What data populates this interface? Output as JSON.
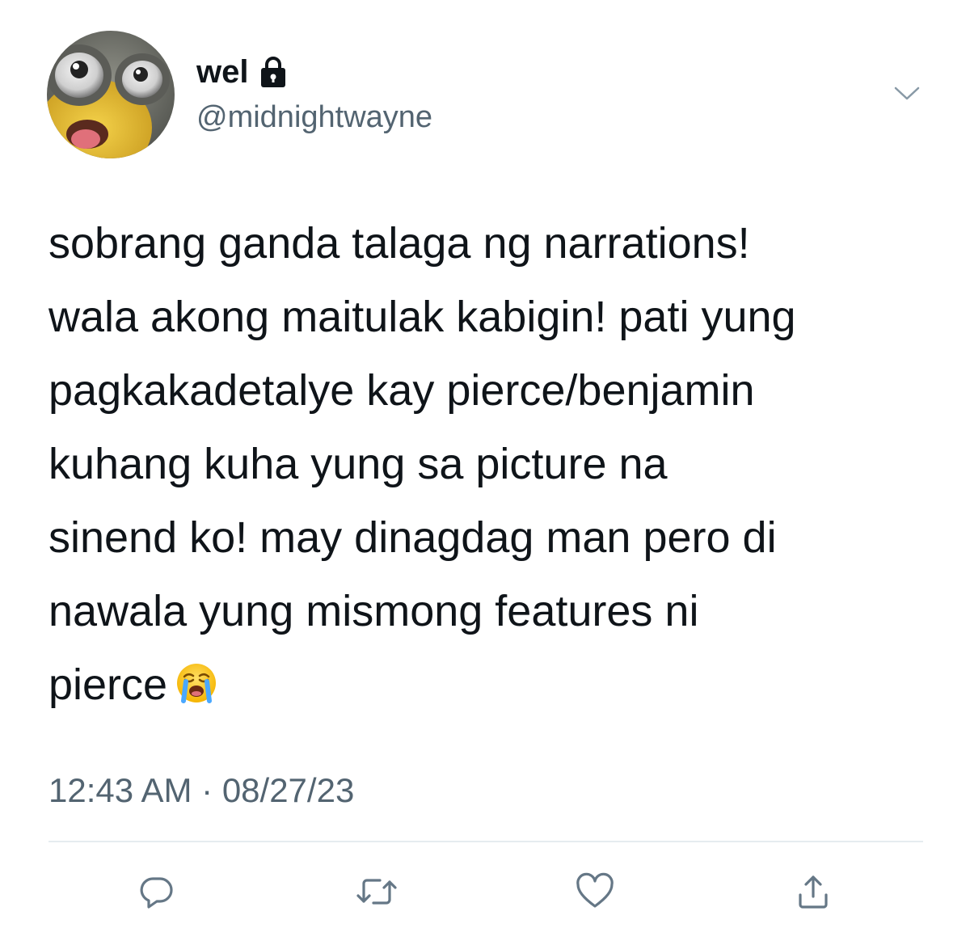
{
  "user": {
    "display_name": "wel",
    "handle": "@midnightwayne",
    "protected_icon": "lock-icon",
    "avatar_icon": "minion-avatar"
  },
  "tweet": {
    "text": "sobrang ganda talaga ng narrations!\nwala akong maitulak kabigin! pati yung\npagkakadetalye kay pierce/benjamin\nkuhang kuha yung sa picture na\nsinend ko! may dinagdag man pero di\nnawala yung mismong features ni\npierce",
    "emoji": "loudly-crying-face",
    "time": "12:43 AM",
    "separator": "·",
    "date": "08/27/23"
  },
  "menu": {
    "icon": "chevron-down-icon"
  },
  "actions": [
    {
      "name": "reply",
      "icon": "reply-icon"
    },
    {
      "name": "retweet",
      "icon": "retweet-icon"
    },
    {
      "name": "like",
      "icon": "heart-icon"
    },
    {
      "name": "share",
      "icon": "share-icon"
    }
  ],
  "colors": {
    "text_primary": "#0f1419",
    "text_secondary": "#536471",
    "icon_gray": "#657786",
    "divider": "#e6ecf0"
  }
}
